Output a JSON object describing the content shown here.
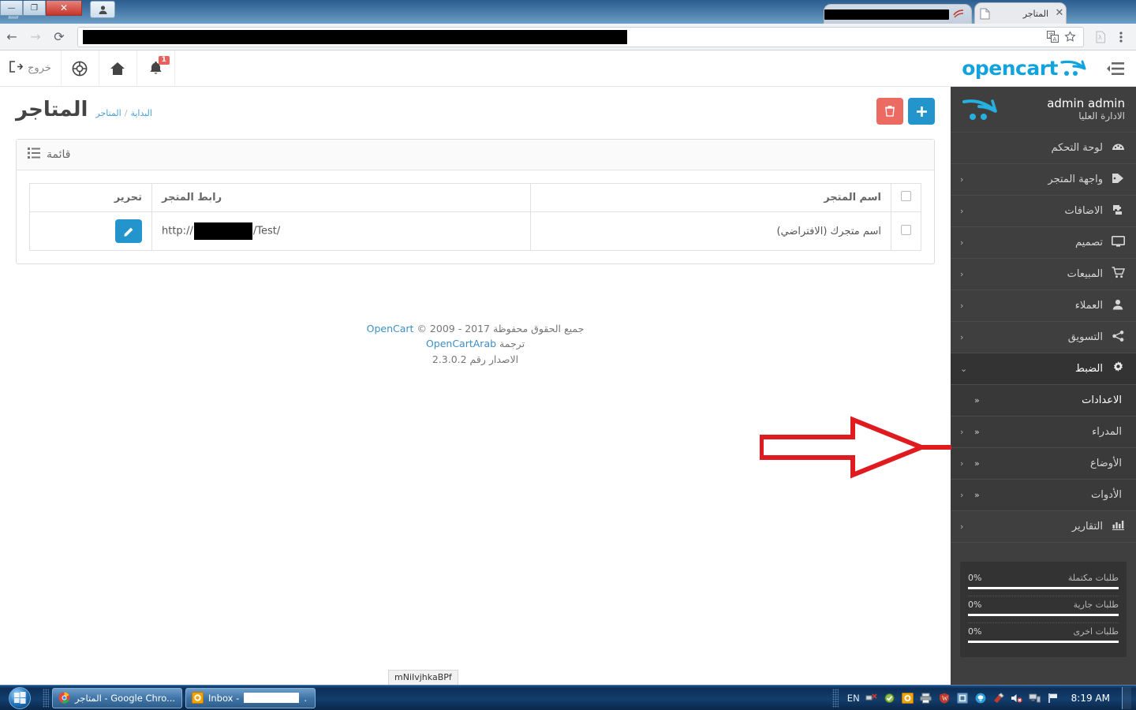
{
  "browser": {
    "tabs": [
      {
        "title": "المتاجر",
        "favicon": "page-icon",
        "active": true,
        "redacted": false
      },
      {
        "title": "",
        "favicon": "outlook-icon",
        "active": false,
        "redacted": true
      }
    ],
    "new_tab_label": "+",
    "address_value": "",
    "address_redacted": true,
    "nav": {
      "back": "←",
      "forward": "→",
      "reload": "⟳"
    },
    "omni_icons": [
      "translate-icon",
      "star-icon"
    ],
    "toolbar_icons": [
      "pdf-extension-icon",
      "chrome-menu-icon"
    ],
    "window_controls": {
      "minimize": "—",
      "maximize": "❐",
      "close": "✕"
    }
  },
  "oc_header": {
    "logout_label": "خروج",
    "icons": [
      "logout-icon",
      "lifebuoy-icon",
      "home-icon",
      "bell-icon"
    ],
    "notification_count": "1",
    "logo_text": "opencart",
    "sidebar_toggle": "menu-collapse-icon"
  },
  "sidebar": {
    "profile": {
      "name": "admin admin",
      "role": "الادارة العليا"
    },
    "items": [
      {
        "label": "لوحة التحكم",
        "icon": "dashboard-icon",
        "caret": "",
        "active": false,
        "sub": false
      },
      {
        "label": "واجهة المتجر",
        "icon": "tag-icon",
        "caret": "‹",
        "active": false,
        "sub": false
      },
      {
        "label": "الاضافات",
        "icon": "puzzle-icon",
        "caret": "‹",
        "active": false,
        "sub": false
      },
      {
        "label": "تصميم",
        "icon": "monitor-icon",
        "caret": "‹",
        "active": false,
        "sub": false
      },
      {
        "label": "المبيعات",
        "icon": "cart-icon",
        "caret": "‹",
        "active": false,
        "sub": false
      },
      {
        "label": "العملاء",
        "icon": "user-icon",
        "caret": "‹",
        "active": false,
        "sub": false
      },
      {
        "label": "التسويق",
        "icon": "share-icon",
        "caret": "‹",
        "active": false,
        "sub": false
      },
      {
        "label": "الضبط",
        "icon": "gear-icon",
        "caret": "⌄",
        "active": true,
        "sub": false
      },
      {
        "label": "الاعدادات",
        "icon": "",
        "caret": "",
        "active": false,
        "sub": true,
        "chev": "«",
        "highlight": true
      },
      {
        "label": "المدراء",
        "icon": "",
        "caret": "‹",
        "active": false,
        "sub": true,
        "chev": "«"
      },
      {
        "label": "الأوضاع",
        "icon": "",
        "caret": "‹",
        "active": false,
        "sub": true,
        "chev": "«"
      },
      {
        "label": "الأدوات",
        "icon": "",
        "caret": "‹",
        "active": false,
        "sub": true,
        "chev": "«"
      },
      {
        "label": "التقارير",
        "icon": "chart-icon",
        "caret": "‹",
        "active": false,
        "sub": false
      }
    ],
    "stats": [
      {
        "name": "طلبات مكتملة",
        "percent": "0%"
      },
      {
        "name": "طلبات جارية",
        "percent": "0%"
      },
      {
        "name": "طلبات اخرى",
        "percent": "0%"
      }
    ]
  },
  "main": {
    "page_title": "المتاجر",
    "breadcrumb": {
      "home": "البداية",
      "separator": "/",
      "current": "المتاجر"
    },
    "actions": {
      "delete_label": "🗑",
      "add_label": "+"
    },
    "panel": {
      "heading": "قائمة",
      "list_icon": "list-icon"
    },
    "table": {
      "headers": {
        "check": "",
        "name": "اسم المتجر",
        "url": "رابط المتجر",
        "edit": "تحرير"
      },
      "rows": [
        {
          "name": "اسم متجرك (الافتراضي)",
          "name_bold_part": "(الافتراضي)",
          "url_prefix": "/http://",
          "url_suffix": "/Test",
          "url_redacted": true,
          "edit_icon": "pencil-icon"
        }
      ]
    },
    "footer": {
      "line1_copyright": "جميع الحقوق محفوظة",
      "line1_brand": "OpenCart",
      "line1_years": "© 2009 - 2017",
      "line2_prefix": "ترجمة",
      "line2_brand": "OpenCartArab",
      "line3": "الاصدار رقم 2.3.0.2"
    },
    "status_tooltip": "mNiIvjhkaBPf"
  },
  "annotation": {
    "type": "arrow",
    "direction": "right",
    "color": "#e01b20"
  },
  "taskbar": {
    "start": "windows-orb-icon",
    "buttons": [
      {
        "label": "المتاجر - Google Chro...",
        "icon": "chrome-icon",
        "redacted": false
      },
      {
        "label": "Inbox -",
        "icon": "outlook-icon",
        "redacted": true,
        "suffix": "."
      }
    ],
    "tray": {
      "language": "EN",
      "icons": [
        "network-disconnect-icon",
        "antivirus-icon",
        "outlook-icon",
        "printer-icon",
        "shield-icon",
        "app-icon",
        "messenger-icon",
        "ccleaner-icon",
        "volume-mute-icon",
        "network-icon",
        "flag-icon"
      ],
      "clock": "8:19 AM"
    }
  },
  "colors": {
    "accent_blue": "#2495cc",
    "danger_red": "#eb6a62",
    "sidebar_bg": "#3f3f3f",
    "logo_blue": "#13a3dc",
    "annotation_red": "#e01b20"
  }
}
